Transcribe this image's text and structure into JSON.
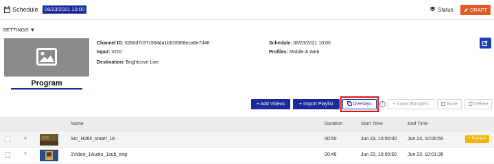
{
  "header": {
    "title": "Schedule",
    "date_chip": "06/23/2021 10:00",
    "status_label": "Status",
    "draft_label": "DRAFT",
    "draft_icon": "pencil-icon"
  },
  "settings_label": "SETTINGS ▼",
  "program_label": "Program",
  "channel": {
    "channel_id_label": "Channel ID:",
    "channel_id_value": "6260d7c97c594da1b628368eca8e7d48",
    "input_label": "Input:",
    "input_value": "VOD",
    "destination_label": "Destination:",
    "destination_value": "Brightcove Live",
    "schedule_label": "Schedule:",
    "schedule_value": "06/23/2021 10:00",
    "profiles_label": "Profiles:",
    "profiles_value": "Mobile & Web"
  },
  "toolbar": {
    "add_videos": "+ Add Videos",
    "import_playlist": "+ Import Playlist",
    "overlays": "Overlays",
    "insert_bumpers": "+ Insert Bumpers",
    "save": "Save",
    "delete": "Delete"
  },
  "table": {
    "columns": [
      "Name",
      "Duration",
      "Start Time",
      "End Time"
    ],
    "rows": [
      {
        "name": "Src_H264_smart_18",
        "duration": "00:50",
        "start": "Jun 23, 10:00:00",
        "end": "Jun 23, 10:00:50",
        "badge": "+ Bumper"
      },
      {
        "name": "1Video_1Audio_1sub_eng",
        "duration": "00:46",
        "start": "Jun 23, 10:00:50",
        "end": "Jun 23, 10:01:36"
      }
    ]
  },
  "colors": {
    "accent": "#1a2a9a",
    "draft": "#e05a26",
    "bumper": "#f5b400",
    "highlight": "#e01010"
  }
}
